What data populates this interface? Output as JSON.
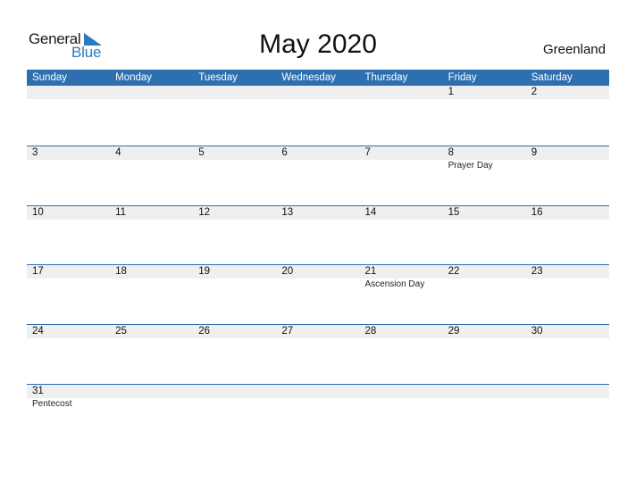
{
  "logo": {
    "line1": "General",
    "line2": "Blue",
    "accent_color": "#2a7ac4"
  },
  "title": "May 2020",
  "country": "Greenland",
  "header_color": "#2e6fb0",
  "weekdays": [
    "Sunday",
    "Monday",
    "Tuesday",
    "Wednesday",
    "Thursday",
    "Friday",
    "Saturday"
  ],
  "weeks": [
    [
      {
        "day": ""
      },
      {
        "day": ""
      },
      {
        "day": ""
      },
      {
        "day": ""
      },
      {
        "day": ""
      },
      {
        "day": "1"
      },
      {
        "day": "2"
      }
    ],
    [
      {
        "day": "3"
      },
      {
        "day": "4"
      },
      {
        "day": "5"
      },
      {
        "day": "6"
      },
      {
        "day": "7"
      },
      {
        "day": "8",
        "event": "Prayer Day"
      },
      {
        "day": "9"
      }
    ],
    [
      {
        "day": "10"
      },
      {
        "day": "11"
      },
      {
        "day": "12"
      },
      {
        "day": "13"
      },
      {
        "day": "14"
      },
      {
        "day": "15"
      },
      {
        "day": "16"
      }
    ],
    [
      {
        "day": "17"
      },
      {
        "day": "18"
      },
      {
        "day": "19"
      },
      {
        "day": "20"
      },
      {
        "day": "21",
        "event": "Ascension Day"
      },
      {
        "day": "22"
      },
      {
        "day": "23"
      }
    ],
    [
      {
        "day": "24"
      },
      {
        "day": "25"
      },
      {
        "day": "26"
      },
      {
        "day": "27"
      },
      {
        "day": "28"
      },
      {
        "day": "29"
      },
      {
        "day": "30"
      }
    ],
    [
      {
        "day": "31",
        "event": "Pentecost"
      },
      {
        "day": ""
      },
      {
        "day": ""
      },
      {
        "day": ""
      },
      {
        "day": ""
      },
      {
        "day": ""
      },
      {
        "day": ""
      }
    ]
  ]
}
